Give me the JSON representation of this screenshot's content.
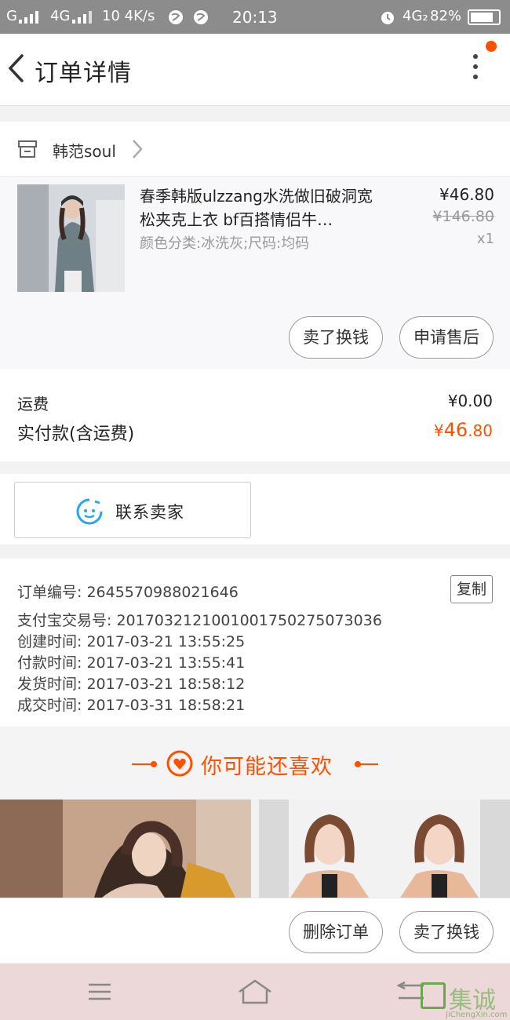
{
  "status_bar": {
    "left_text": "G",
    "net1": "4G",
    "speed": "10 4K/s",
    "time": "20:13",
    "net2": "4G₂",
    "battery": "82%"
  },
  "header": {
    "title": "订单详情"
  },
  "shop": {
    "name": "韩范soul"
  },
  "item": {
    "title": "春季韩版ulzzang水洗做旧破洞宽松夹克上衣 bf百搭情侣牛…",
    "spec": "颜色分类:冰洗灰;尺码:均码",
    "price": "¥46.80",
    "original_price": "¥146.80",
    "quantity": "x1",
    "btn_sell": "卖了换钱",
    "btn_after_sale": "申请售后"
  },
  "fees": {
    "shipping_label": "运费",
    "shipping_value": "¥0.00",
    "paid_label": "实付款(含运费)",
    "paid_currency": "¥",
    "paid_int": "46",
    "paid_dec": ".80"
  },
  "contact": {
    "label": "联系卖家"
  },
  "order_info": {
    "order_no": "订单编号: 2645570988021646",
    "copy_label": "复制",
    "alipay_no": "支付宝交易号: 2017032121001001750275073036",
    "created": "创建时间: 2017-03-21  13:55:25",
    "paid": "付款时间: 2017-03-21  13:55:41",
    "shipped": "发货时间: 2017-03-21  18:58:12",
    "completed": "成交时间: 2017-03-31  18:58:21"
  },
  "recommend": {
    "title": "你可能还喜欢"
  },
  "bottom_actions": {
    "delete": "删除订单",
    "sell": "卖了换钱"
  },
  "watermark": {
    "text": "集诚信",
    "sub": "JiChengXin.com"
  },
  "colors": {
    "accent": "#ff5000",
    "status_bar": "#8c8c8c",
    "nav_bar": "#ecd8d9"
  }
}
